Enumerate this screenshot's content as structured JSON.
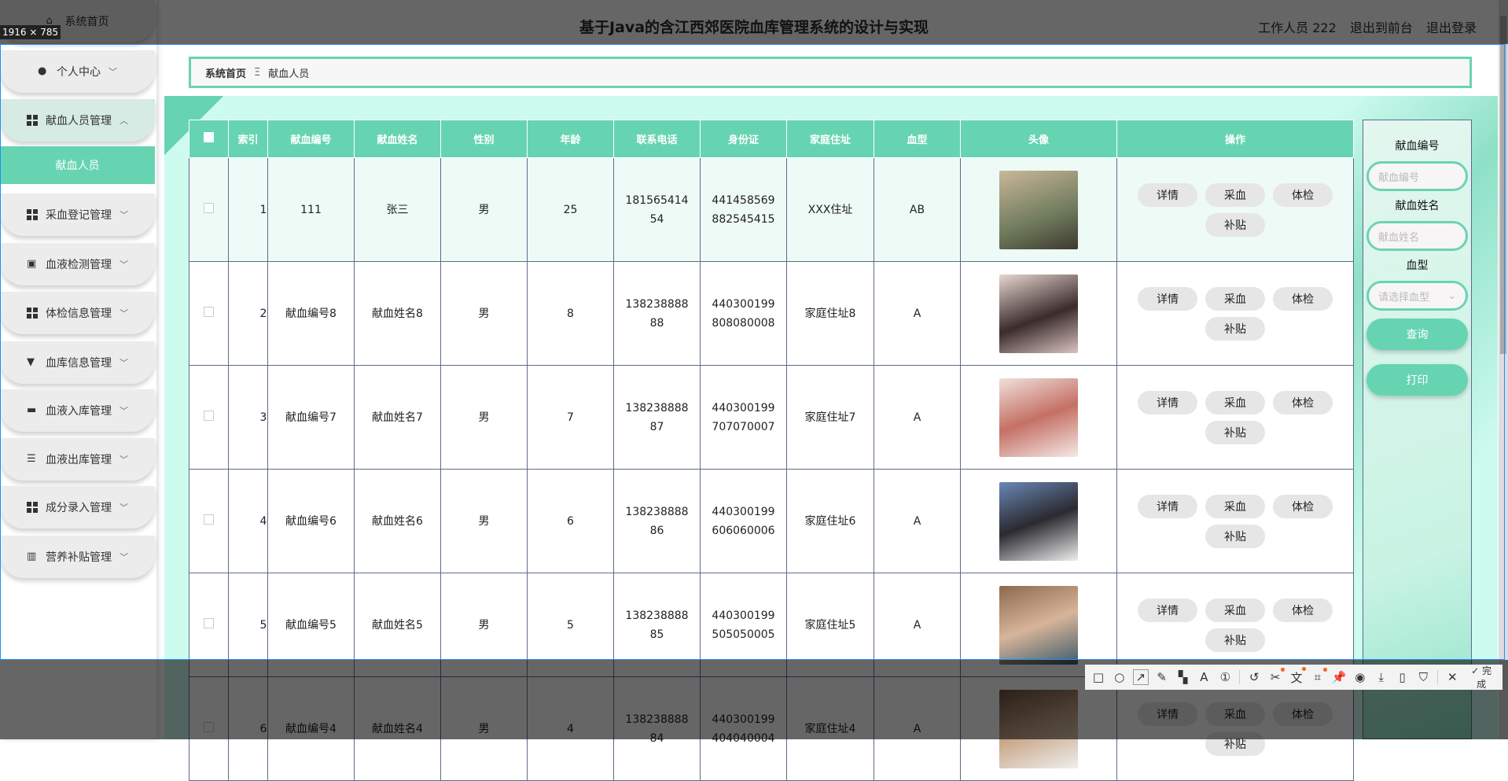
{
  "header": {
    "title": "基于Java的含江西郊医院血库管理系统的设计与实现",
    "user": "工作人员 222",
    "to_front": "退出到前台",
    "logout": "退出登录"
  },
  "sidebar": {
    "items": [
      {
        "label": "系统首页",
        "icon": "home-icon"
      },
      {
        "label": "个人中心",
        "icon": "user-icon"
      },
      {
        "label": "献血人员管理",
        "icon": "grid-icon",
        "open": true
      },
      {
        "label": "献血人员",
        "active": true
      },
      {
        "label": "采血登记管理",
        "icon": "grid-icon"
      },
      {
        "label": "血液检测管理",
        "icon": "clipboard-icon"
      },
      {
        "label": "体检信息管理",
        "icon": "grid-icon"
      },
      {
        "label": "血库信息管理",
        "icon": "brush-icon"
      },
      {
        "label": "血液入库管理",
        "icon": "inbox-icon"
      },
      {
        "label": "血液出库管理",
        "icon": "sliders-icon"
      },
      {
        "label": "成分录入管理",
        "icon": "grid-icon"
      },
      {
        "label": "营养补贴管理",
        "icon": "bar-chart-icon"
      }
    ]
  },
  "breadcrumb": {
    "home": "系统首页",
    "sep": "Ξ",
    "current": "献血人员"
  },
  "table": {
    "headers": [
      "索引",
      "献血编号",
      "献血姓名",
      "性别",
      "年龄",
      "联系电话",
      "身份证",
      "家庭住址",
      "血型",
      "头像",
      "操作"
    ],
    "actions": [
      "详情",
      "采血",
      "体检",
      "补贴"
    ],
    "rows": [
      [
        "1",
        "111",
        "张三",
        "男",
        "25",
        "18156541454",
        "441458569882545415",
        "XXX住址",
        "AB"
      ],
      [
        "2",
        "献血编号8",
        "献血姓名8",
        "男",
        "8",
        "13823888888",
        "440300199808080008",
        "家庭住址8",
        "A"
      ],
      [
        "3",
        "献血编号7",
        "献血姓名7",
        "男",
        "7",
        "13823888887",
        "440300199707070007",
        "家庭住址7",
        "A"
      ],
      [
        "4",
        "献血编号6",
        "献血姓名6",
        "男",
        "6",
        "13823888886",
        "440300199606060006",
        "家庭住址6",
        "A"
      ],
      [
        "5",
        "献血编号5",
        "献血姓名5",
        "男",
        "5",
        "13823888885",
        "440300199505050005",
        "家庭住址5",
        "A"
      ],
      [
        "6",
        "献血编号4",
        "献血姓名4",
        "男",
        "4",
        "13823888884",
        "440300199404040004",
        "家庭住址4",
        "A"
      ]
    ]
  },
  "search": {
    "id_label": "献血编号",
    "id_placeholder": "献血编号",
    "name_label": "献血姓名",
    "name_placeholder": "献血姓名",
    "type_label": "血型",
    "type_placeholder": "请选择血型",
    "query": "查询",
    "print": "打印"
  },
  "overlay": {
    "size": "1916 × 785",
    "done": "完成",
    "tools": [
      "rect-tool",
      "ellipse-tool",
      "arrow-tool",
      "pen-tool",
      "mosaic-tool",
      "text-tool",
      "number-tool",
      "undo",
      "screenshot-crop",
      "translate",
      "ocr",
      "pin",
      "record",
      "download",
      "phone",
      "bookmark",
      "close"
    ]
  },
  "colors": {
    "accent": "#67d4b1"
  }
}
